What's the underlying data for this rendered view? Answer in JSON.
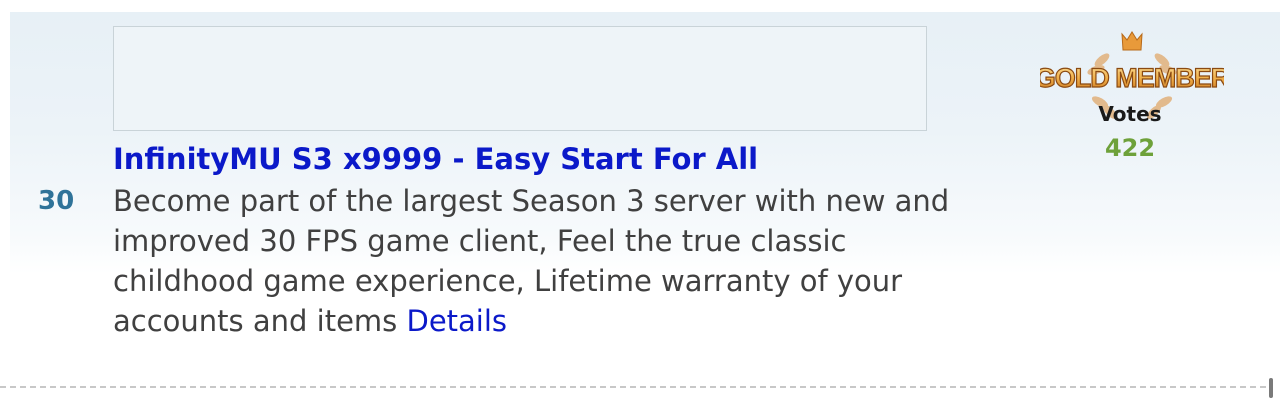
{
  "listing": {
    "rank": "30",
    "title": "InfinityMU S3 x9999 - Easy Start For All",
    "description": "Become part of the largest Season 3 server with new and improved 30 FPS game client, Feel the true classic childhood game experience, Lifetime warranty of your accounts and items",
    "details_label": "Details",
    "badge_text": "GOLD MEMBER",
    "votes_label": "Votes",
    "votes_count": "422"
  },
  "colors": {
    "title_link": "#0b19c9",
    "rank": "#2f7399",
    "votes_count": "#6ea13a",
    "badge_gold": "#e8a93c"
  }
}
